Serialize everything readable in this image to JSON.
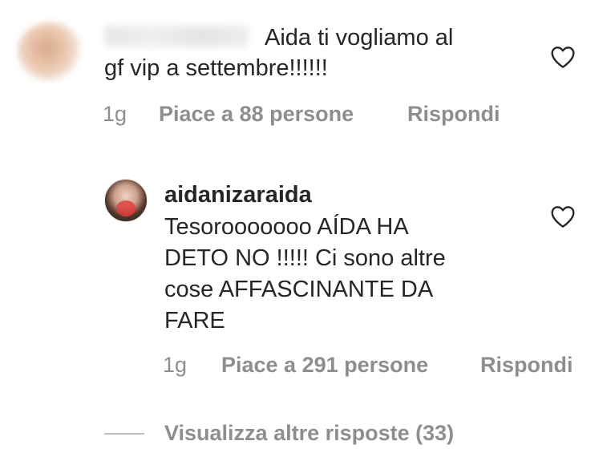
{
  "comment1": {
    "text_line1": "Aida ti vogliamo al",
    "text_line2": "gf vip a settembre!!!!!!",
    "time": "1g",
    "likes": "Piace a 88 persone",
    "reply": "Rispondi"
  },
  "reply1": {
    "username": "aidanizaraida",
    "text_line1": "Tesorooooooo AÍDA HA",
    "text_line2": "DETO NO !!!!! Ci sono altre",
    "text_line3": "cose AFFASCINANTE DA",
    "text_line4": "FARE",
    "time": "1g",
    "likes": "Piace a 291 persone",
    "reply": "Rispondi"
  },
  "view_more_replies": "Visualizza altre risposte (33)",
  "icons": {
    "like": "heart-outline-icon"
  }
}
